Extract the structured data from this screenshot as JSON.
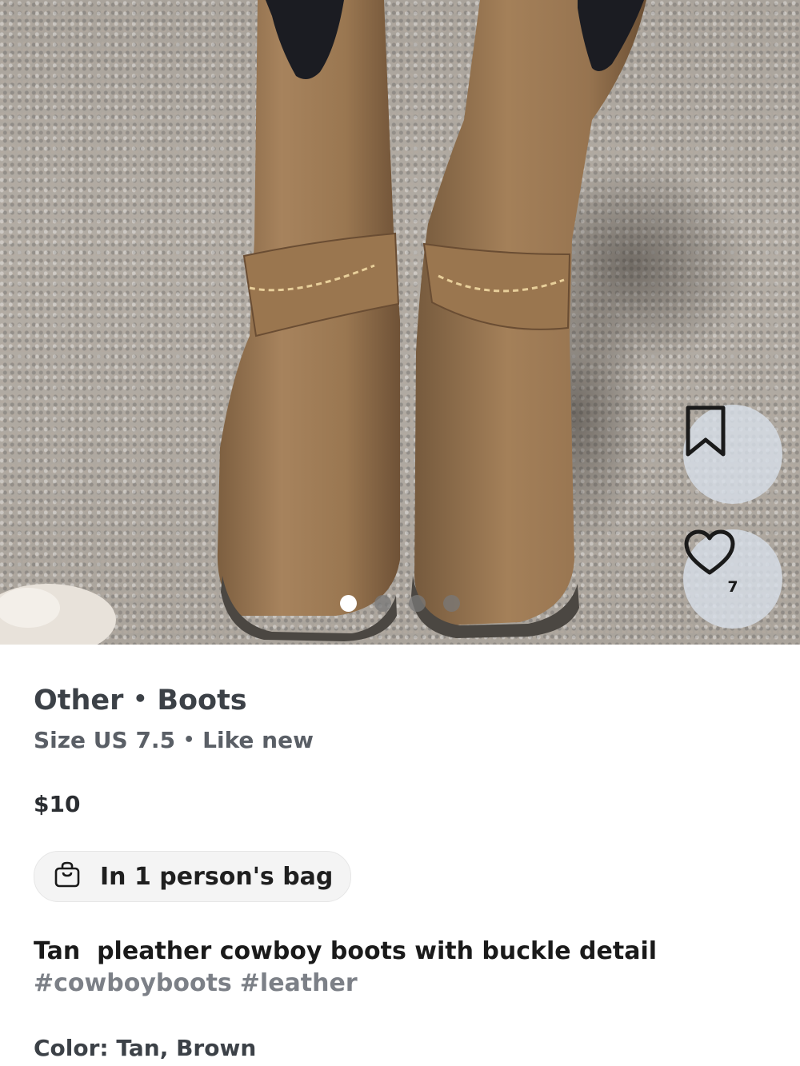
{
  "listing": {
    "photo": {
      "description_icon": "product-photo",
      "carousel": {
        "total": 4,
        "active_index": 0
      }
    },
    "actions": {
      "save_icon": "bookmark-icon",
      "like_icon": "heart-icon",
      "like_count": "7"
    },
    "brand": "Other",
    "category": "Boots",
    "separator": "•",
    "size": "Size US 7.5",
    "condition": "Like new",
    "price": "$10",
    "bag_status": {
      "icon": "shopping-bag-icon",
      "label": "In 1 person's bag"
    },
    "description": "Tan  pleather cowboy boots with buckle detail",
    "hashtags": [
      "#cowboyboots",
      "#leather"
    ],
    "color_line": "Color: Tan, Brown"
  },
  "colors": {
    "boot_leather": "#9c7a55",
    "carpet": "#aba59d",
    "pill_background": "#f4f4f4",
    "hashtag": "#7c8087"
  }
}
